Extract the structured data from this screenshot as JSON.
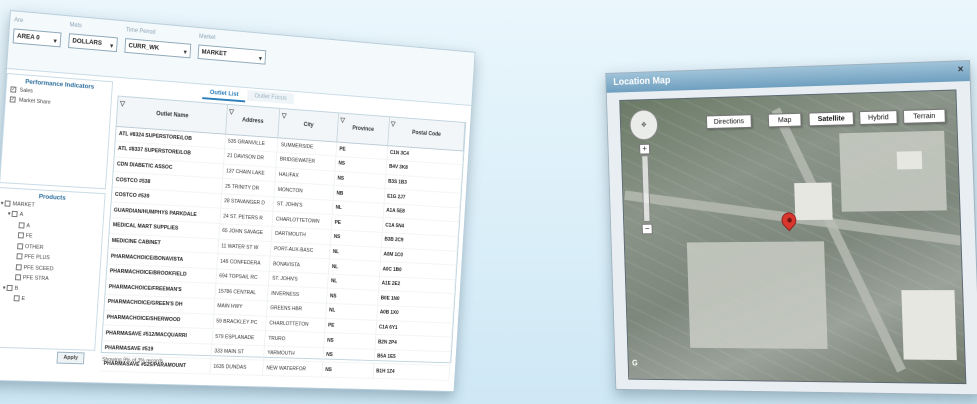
{
  "filters": [
    {
      "label": "Are",
      "value": "AREA 0"
    },
    {
      "label": "Mets",
      "value": "DOLLARS"
    },
    {
      "label": "Time Period",
      "value": "CURR_WK"
    },
    {
      "label": "Market",
      "value": "MARKET"
    }
  ],
  "tabs": [
    {
      "label": "Outlet List",
      "active": true
    },
    {
      "label": "Outlet Focus",
      "active": false
    }
  ],
  "performance": {
    "title": "Performance Indicators",
    "items": [
      {
        "label": "Sales",
        "checked": true
      },
      {
        "label": "Market Share",
        "checked": true
      }
    ]
  },
  "products": {
    "title": "Products",
    "items": [
      "MARKET",
      "A",
      "A",
      "FE",
      "OTHER",
      "PFE PLUS",
      "PFE SCEED",
      "PFE STRA",
      "B",
      "E"
    ]
  },
  "apply_label": "Apply",
  "grid": {
    "columns": [
      "Outlet Name",
      "Address",
      "City",
      "Province",
      "Postal Code"
    ],
    "rows": [
      [
        "ATL #8324 SUPERSTORE/LOB",
        "535 GRANVILLE",
        "SUMMERSIDE",
        "PE",
        "C1N 3C4"
      ],
      [
        "ATL #8337 SUPERSTORE/LOB",
        "21 DAVISON DR",
        "BRIDGEWATER",
        "NS",
        "B4V 3K8"
      ],
      [
        "CDN DIABETIC ASSOC",
        "137 CHAIN LAKE",
        "HALIFAX",
        "NS",
        "B3S 1B3"
      ],
      [
        "COSTCO #538",
        "25 TRINITY DR",
        "MONCTON",
        "NB",
        "E1G 2J7"
      ],
      [
        "COSTCO #539",
        "28 STAVANGER D",
        "ST. JOHN'S",
        "NL",
        "A1A 5E8"
      ],
      [
        "GUARDIAN/HUMPHYS PARKDALE",
        "24 ST. PETERS R",
        "CHARLOTTETOWN",
        "PE",
        "C1A 5N4"
      ],
      [
        "MEDICAL MART SUPPLIES",
        "65 JOHN SAVAGE",
        "DARTMOUTH",
        "NS",
        "B3B 2C9"
      ],
      [
        "MEDICINE CABINET",
        "11 WATER ST W",
        "PORT-AUX-BASC",
        "NL",
        "A0M 1C0"
      ],
      [
        "PHARMACHOICE/BONAVISTA",
        "145 CONFEDERA",
        "BONAVISTA",
        "NL",
        "A0C 1B0"
      ],
      [
        "PHARMACHOICE/BROOKFIELD",
        "694 TOPSAIL RC",
        "ST. JOHN'S",
        "NL",
        "A1E 2E2"
      ],
      [
        "PHARMACHOICE/FREEMAN'S",
        "15786 CENTRAL",
        "INVERNESS",
        "NS",
        "B0E 1N0"
      ],
      [
        "PHARMACHOICE/GREEN'S DH",
        "MAIN HWY",
        "GREENS HBR",
        "NL",
        "A0B 1X0"
      ],
      [
        "PHARMACHOICE/SHERWOOD",
        "59 BRACKLEY PC",
        "CHARLOTTETON",
        "PE",
        "C1A 6Y1"
      ],
      [
        "PHARMASAVE #512/MACQUARRI",
        "579 ESPLANADE",
        "TRURO",
        "NS",
        "B2N 2P4"
      ],
      [
        "PHARMASAVE #519",
        "333 MAIN ST",
        "YARMOUTH",
        "NS",
        "B5A 1E5"
      ],
      [
        "PHARMASAVE #525/PARAMOUNT",
        "1635 DUNDAS",
        "NEW WATERFOR",
        "NS",
        "B1H 1Z4"
      ]
    ]
  },
  "status_text": "Showing 9% of 3% records",
  "map": {
    "title": "Location Map",
    "buttons": [
      "Directions",
      "Map",
      "Satellite",
      "Hybrid",
      "Terrain"
    ],
    "active_button": "Satellite",
    "close_glyph": "×"
  }
}
